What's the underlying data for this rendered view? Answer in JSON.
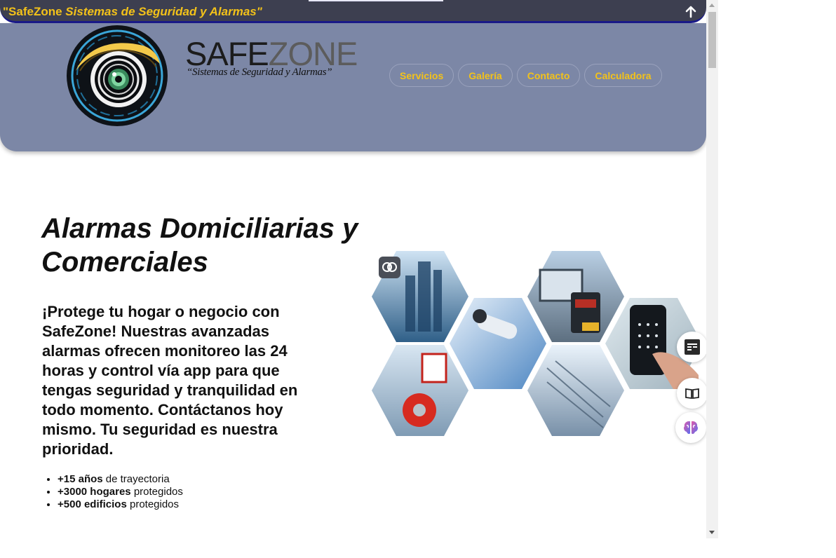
{
  "topbar": {
    "title_lead": "\"SafeZone",
    "title_rest": " Sistemas de Seguridad y Alarmas\""
  },
  "header": {
    "brand_name_part1": "SAFE",
    "brand_name_part2": "ZONE",
    "brand_tagline": "“Sistemas de Seguridad y Alarmas”",
    "nav": [
      {
        "label": "Servicios"
      },
      {
        "label": "Galería"
      },
      {
        "label": "Contacto"
      },
      {
        "label": "Calculadora"
      }
    ]
  },
  "hero": {
    "title": "Alarmas Domiciliarias y Comerciales",
    "text": "¡Protege tu hogar o negocio con SafeZone! Nuestras avanzadas alarmas ofrecen monitoreo las 24 horas y control vía app para que tengas seguridad y tranquilidad en todo momento. Contáctanos hoy mismo. Tu seguridad es nuestra prioridad.",
    "stats": [
      {
        "strong": "+15 años",
        "rest": " de trayectoria"
      },
      {
        "strong": "+3000 hogares",
        "rest": " protegidos"
      },
      {
        "strong": "+500 edificios",
        "rest": " protegidos"
      }
    ]
  },
  "icons": {
    "scroll_top": "arrow-up-icon",
    "image_badge": "brain-icon",
    "tool_1": "reader-mode-icon",
    "tool_2": "open-book-icon",
    "tool_3": "brain-icon"
  },
  "colors": {
    "accent": "#f3c219",
    "header_bg": "#7c87a6",
    "topbar_bg": "#3d3f50"
  }
}
